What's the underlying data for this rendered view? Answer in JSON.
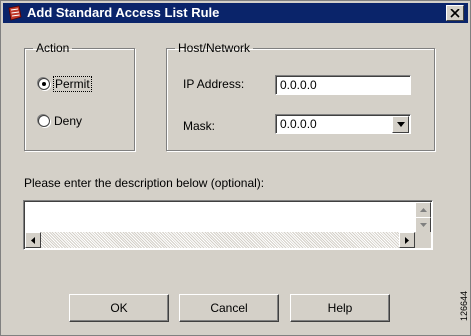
{
  "window": {
    "title": "Add Standard Access List Rule",
    "icon": "app-icon",
    "close_icon": "close-icon"
  },
  "action": {
    "legend": "Action",
    "options": [
      {
        "label": "Permit",
        "checked": true
      },
      {
        "label": "Deny",
        "checked": false
      }
    ]
  },
  "host_network": {
    "legend": "Host/Network",
    "ip_label": "IP Address:",
    "ip_value": "0.0.0.0",
    "mask_label": "Mask:",
    "mask_value": "0.0.0.0"
  },
  "description": {
    "prompt": "Please enter the description below (optional):",
    "value": ""
  },
  "buttons": {
    "ok": "OK",
    "cancel": "Cancel",
    "help": "Help"
  },
  "figure_id": "126644"
}
